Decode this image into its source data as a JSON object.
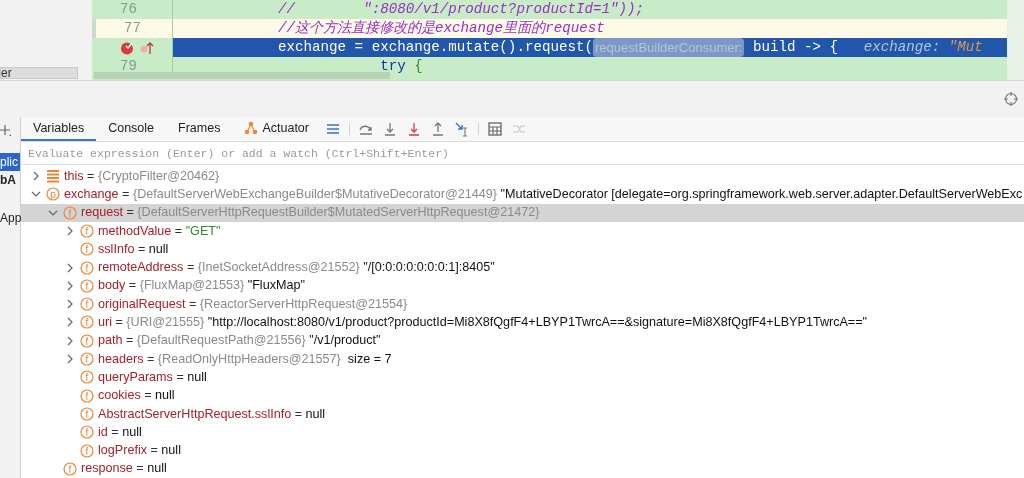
{
  "editor": {
    "side_panel": {
      "text": "er"
    },
    "lines": [
      {
        "number": "76",
        "caret": false,
        "execution_point": false,
        "breakpoint": false,
        "parts": [
          {
            "kind": "comment",
            "text": "//        \":8080/v1/product?productId=1\"));"
          }
        ]
      },
      {
        "number": "77",
        "caret": true,
        "execution_point": false,
        "breakpoint": false,
        "parts": [
          {
            "kind": "comment",
            "text": "//这个方法直接修改的是exchange里面的request"
          }
        ]
      },
      {
        "caret": false,
        "execution_point": true,
        "breakpoint": true,
        "parts": [
          {
            "kind": "code",
            "text": "exchange = exchange.mutate().request("
          },
          {
            "kind": "hint",
            "text": "requestBuilderConsumer:"
          },
          {
            "kind": "code",
            "text": " build -> {   "
          },
          {
            "kind": "inline_name",
            "text": "exchange: "
          },
          {
            "kind": "inline_value",
            "text": "\"Mut"
          }
        ]
      },
      {
        "number": "79",
        "caret": false,
        "execution_point": false,
        "breakpoint": false,
        "parts": [
          {
            "kind": "keyword",
            "text": "            try"
          },
          {
            "kind": "brace",
            "text": " {"
          }
        ]
      }
    ]
  },
  "debugger": {
    "side_items": [
      {
        "label": "plic",
        "selected": true,
        "bold": false
      },
      {
        "label": "bA",
        "selected": false,
        "bold": true
      },
      {
        "label": "App",
        "selected": false,
        "bold": false
      }
    ],
    "tabs": [
      {
        "label": "Variables",
        "selected": true,
        "kind": "plain"
      },
      {
        "label": "Console",
        "selected": false,
        "kind": "plain"
      },
      {
        "label": "Frames",
        "selected": false,
        "kind": "plain"
      },
      {
        "label": "Actuator",
        "selected": false,
        "kind": "actuator"
      }
    ],
    "evaluate": {
      "placeholder": "Evaluate expression (Enter) or add a watch (Ctrl+Shift+Enter)"
    },
    "variables": [
      {
        "kind": "object",
        "expanded": false,
        "selected": false,
        "parts": [
          {
            "kind": "name",
            "text": "this"
          },
          {
            "kind": "op",
            "text": "="
          },
          {
            "kind": "type",
            "text": "{CryptoFilter@20462}"
          }
        ]
      },
      {
        "kind": "parameter",
        "glyph": "p",
        "expanded": true,
        "selected": false,
        "parts": [
          {
            "kind": "name",
            "text": "exchange"
          },
          {
            "kind": "op",
            "text": "="
          },
          {
            "kind": "type",
            "text": "{DefaultServerWebExchangeBuilder$MutativeDecorator@21449}"
          },
          {
            "kind": "plain",
            "text": "\"MutativeDecorator [delegate=org.springframework.web.server.adapter.DefaultServerWebExc"
          }
        ],
        "children": [
          {
            "kind": "field",
            "glyph": "f",
            "expanded": true,
            "selected": true,
            "parts": [
              {
                "kind": "name",
                "text": "request"
              },
              {
                "kind": "op",
                "text": "="
              },
              {
                "kind": "type",
                "text": "{DefaultServerHttpRequestBuilder$MutatedServerHttpRequest@21472}"
              }
            ],
            "children": [
              {
                "kind": "field",
                "glyph": "f",
                "expanded": false,
                "selected": false,
                "parts": [
                  {
                    "kind": "name",
                    "text": "methodValue"
                  },
                  {
                    "kind": "op",
                    "text": "="
                  },
                  {
                    "kind": "string",
                    "text": "\"GET\""
                  }
                ]
              },
              {
                "kind": "field",
                "glyph": "f",
                "selected": false,
                "parts": [
                  {
                    "kind": "name",
                    "text": "sslInfo"
                  },
                  {
                    "kind": "op",
                    "text": "="
                  },
                  {
                    "kind": "plain",
                    "text": "null"
                  }
                ]
              },
              {
                "kind": "field",
                "glyph": "f",
                "expanded": false,
                "selected": false,
                "parts": [
                  {
                    "kind": "name",
                    "text": "remoteAddress"
                  },
                  {
                    "kind": "op",
                    "text": "="
                  },
                  {
                    "kind": "type",
                    "text": "{InetSocketAddress@21552}"
                  },
                  {
                    "kind": "plain",
                    "text": "\"/[0:0:0:0:0:0:0:1]:8405\""
                  }
                ]
              },
              {
                "kind": "field",
                "glyph": "f",
                "expanded": false,
                "selected": false,
                "parts": [
                  {
                    "kind": "name",
                    "text": "body"
                  },
                  {
                    "kind": "op",
                    "text": "="
                  },
                  {
                    "kind": "type",
                    "text": "{FluxMap@21553}"
                  },
                  {
                    "kind": "plain",
                    "text": "\"FluxMap\""
                  }
                ]
              },
              {
                "kind": "field",
                "glyph": "f",
                "expanded": false,
                "selected": false,
                "parts": [
                  {
                    "kind": "name",
                    "text": "originalRequest"
                  },
                  {
                    "kind": "op",
                    "text": "="
                  },
                  {
                    "kind": "type",
                    "text": "{ReactorServerHttpRequest@21554}"
                  }
                ]
              },
              {
                "kind": "field",
                "glyph": "f",
                "expanded": false,
                "selected": false,
                "parts": [
                  {
                    "kind": "name",
                    "text": "uri"
                  },
                  {
                    "kind": "op",
                    "text": "="
                  },
                  {
                    "kind": "type",
                    "text": "{URI@21555}"
                  },
                  {
                    "kind": "plain",
                    "text": "\"http://localhost:8080/v1/product?productId=Mi8X8fQgfF4+LBYP1TwrcA==&signature=Mi8X8fQgfF4+LBYP1TwrcA==\""
                  }
                ]
              },
              {
                "kind": "field",
                "glyph": "f",
                "expanded": false,
                "selected": false,
                "parts": [
                  {
                    "kind": "name",
                    "text": "path"
                  },
                  {
                    "kind": "op",
                    "text": "="
                  },
                  {
                    "kind": "type",
                    "text": "{DefaultRequestPath@21556}"
                  },
                  {
                    "kind": "plain",
                    "text": "\"/v1/product\""
                  }
                ]
              },
              {
                "kind": "field",
                "glyph": "f",
                "expanded": false,
                "selected": false,
                "parts": [
                  {
                    "kind": "name",
                    "text": "headers"
                  },
                  {
                    "kind": "op",
                    "text": "="
                  },
                  {
                    "kind": "type",
                    "text": "{ReadOnlyHttpHeaders@21557}"
                  },
                  {
                    "kind": "plain",
                    "text": " size = 7"
                  }
                ]
              },
              {
                "kind": "field",
                "glyph": "f",
                "selected": false,
                "parts": [
                  {
                    "kind": "name",
                    "text": "queryParams"
                  },
                  {
                    "kind": "op",
                    "text": "="
                  },
                  {
                    "kind": "plain",
                    "text": "null"
                  }
                ]
              },
              {
                "kind": "field",
                "glyph": "f",
                "selected": false,
                "parts": [
                  {
                    "kind": "name",
                    "text": "cookies"
                  },
                  {
                    "kind": "op",
                    "text": "="
                  },
                  {
                    "kind": "plain",
                    "text": "null"
                  }
                ]
              },
              {
                "kind": "field",
                "glyph": "f",
                "selected": false,
                "parts": [
                  {
                    "kind": "name",
                    "text": "AbstractServerHttpRequest.sslInfo"
                  },
                  {
                    "kind": "op",
                    "text": "="
                  },
                  {
                    "kind": "plain",
                    "text": "null"
                  }
                ]
              },
              {
                "kind": "field",
                "glyph": "f",
                "selected": false,
                "parts": [
                  {
                    "kind": "name",
                    "text": "id"
                  },
                  {
                    "kind": "op",
                    "text": "="
                  },
                  {
                    "kind": "plain",
                    "text": "null"
                  }
                ]
              },
              {
                "kind": "field",
                "glyph": "f",
                "selected": false,
                "parts": [
                  {
                    "kind": "name",
                    "text": "logPrefix"
                  },
                  {
                    "kind": "op",
                    "text": "="
                  },
                  {
                    "kind": "plain",
                    "text": "null"
                  }
                ]
              }
            ]
          },
          {
            "kind": "field",
            "glyph": "f",
            "selected": false,
            "parts": [
              {
                "kind": "name",
                "text": "response"
              },
              {
                "kind": "op",
                "text": "="
              },
              {
                "kind": "plain",
                "text": "null"
              }
            ]
          }
        ]
      }
    ]
  }
}
